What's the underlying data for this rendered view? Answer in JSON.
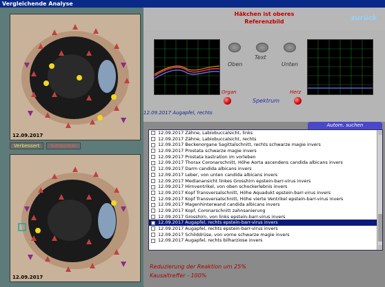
{
  "window": {
    "title": "Vergleichende Analyse"
  },
  "banner": {
    "line1": "Häkchen ist oberes",
    "line2": "Referenzbild"
  },
  "nav": {
    "back_label": "zurück"
  },
  "images": {
    "top_date": "12.09.2017",
    "bottom_date": "12.09.2017",
    "tab_left": "Verbessert",
    "tab_right": "Schlechter"
  },
  "controls": {
    "oben": "Oben",
    "text": "Text",
    "unten": "Unten",
    "organ": "Organ",
    "spektrum": "Spektrum",
    "herz": "Herz"
  },
  "analysis_title": "12.09.2017 Augapfel, rechts",
  "autom_button": "Autom. suchen",
  "list": {
    "items": [
      "12.09.2017  Zähne, Labiobuccalsicht, links",
      "12.09.2017  Zähne, Labiobuccalsicht, rechts",
      "12.09.2017  Beckenorgane Sagittalschnitt, rechts  schwarze magie invers",
      "12.09.2017  Prostata  schwarze magie invers",
      "12.09.2017  Prostata  kastration im vorleben",
      "12.09.2017  Thorax Coronarschnitt, Höhe Aorta ascendens  candida albicans invers",
      "12.09.2017  Darm  candida albicans invers",
      "12.09.2017  Leber, von unten  candida albicans invers",
      "12.09.2017  Medianansicht linkes Grosshirn  epstein-barr-virus invers",
      "12.09.2017  Hirnventrikel, von oben  schockerlebnis invers",
      "12.09.2017  Kopf Transversalschnitt, Höhe Aquadukt  epstein-barr-virus invers",
      "12.09.2017  Kopf Transversalschnitt, Höhe vierte Ventrikel  epstein-barr-virus invers",
      "12.09.2017  Magenhinterwand  candida albicans invers",
      "12.09.2017  Kopf, Coronarschnitt  zahnsanierung",
      "12.09.2017  Grosshirn, von links  epstein-barr-virus invers",
      "12.09.2017  Augapfel, rechts  epstein-barr-virus invers",
      "12.09.2017  Augapfel, rechts  epstein-barr-virus invers",
      "12.09.2017  Schilddrüse, von vorne  schwarze magie invers",
      "12.09.2017  Augapfel, rechts  bilharziose invers"
    ],
    "selected_index": 15
  },
  "result": {
    "reduction": "Reduzierung der Reaktion um 25%",
    "kausal": "Kausaltreffer - 100%"
  },
  "colors": {
    "accent_blue": "#0a2a8a",
    "alert_red": "#c00000",
    "selected_row": "#0a1a7a"
  }
}
